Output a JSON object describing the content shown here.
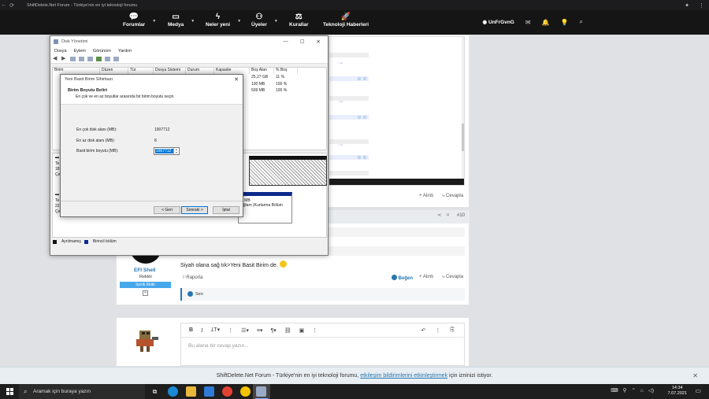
{
  "browser": {
    "tab_title": "ShiftDelete.Net Forum - Türkiye'nin en iyi teknoloji forumu"
  },
  "forum_nav": {
    "items": [
      {
        "label": "Forumlar",
        "icon": "chat-icon"
      },
      {
        "label": "Medya",
        "icon": "video-icon"
      },
      {
        "label": "Neler yeni",
        "icon": "bolt-icon"
      },
      {
        "label": "Üyeler",
        "icon": "users-icon"
      },
      {
        "label": "Kurallar",
        "icon": "scale-icon"
      },
      {
        "label": "Teknoloji Haberleri",
        "icon": "rocket-icon"
      }
    ],
    "username": "UnFrGvnG"
  },
  "disk_mgmt": {
    "title": "Disk Yönetimi",
    "menu": [
      "Dosya",
      "Eylem",
      "Görünüm",
      "Yardım"
    ],
    "columns": [
      "Birim",
      "Düzen",
      "Tür",
      "Dosya Sistemi",
      "Durum",
      "Kapasite",
      "Boş Alan",
      "% Boş"
    ],
    "rows": [
      {
        "free": "25,27 GB",
        "pct": "11 %"
      },
      {
        "free": "100 MB",
        "pct": "100 %"
      },
      {
        "free": "509 MB",
        "pct": "100 %"
      }
    ],
    "disk_labels": [
      "Te",
      "18",
      "Çe",
      "Te",
      "22",
      "Çe"
    ],
    "partition_size": "9 MB",
    "partition_desc": "ağlam (Kurtarma Bölüm",
    "legend": [
      "Ayrılmamış",
      "Birincil bölüm"
    ]
  },
  "wizard": {
    "title": "Yeni Basit Birim Sihirbazı",
    "header": "Birim Boyutu Belirt",
    "subheader": "En çok ve en az boyutlar arasında bir birim boyutu seçin.",
    "max_label": "En çok disk alanı (MB):",
    "max_value": "1907712",
    "min_label": "En az disk alanı (MB):",
    "min_value": "8",
    "size_label": "Basit birim boyutu (MB):",
    "size_value": "1907712",
    "back": "< Geri",
    "next": "Sonraki >",
    "cancel": "İptal"
  },
  "post": {
    "number": "#10",
    "user": "EFI Shell",
    "user_title": "Rektör",
    "user_badge": "İçerik Ekibi",
    "text": "Siyah olana sağ tık>Yeni Basit Birim de.",
    "report": "Raporla",
    "like": "Beğen",
    "quote": "Alıntı",
    "reply": "Cevapla",
    "reactor": "Sen"
  },
  "editor": {
    "placeholder": "Bu alana bir cevap yazın..."
  },
  "cookie": {
    "text_before": "ShiftDelete.Net Forum - Türkiye'nin en iyi teknoloji forumu,",
    "link": "etkileşim bildirimlerini etkinleştirmek",
    "text_after": "için izninizi istiyor."
  },
  "taskbar": {
    "search_placeholder": "Aramak için buraya yazın",
    "time": "14:34",
    "date": "7.07.2021"
  }
}
